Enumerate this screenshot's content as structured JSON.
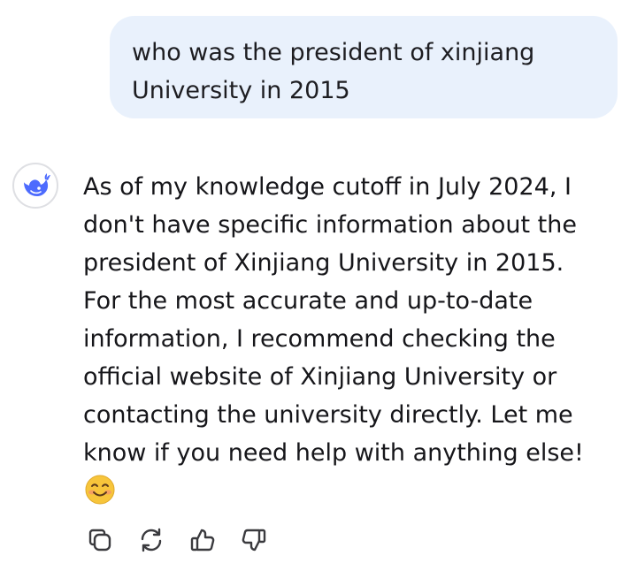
{
  "conversation": {
    "user_message": "who was the president of xinjiang University in 2015",
    "assistant_message": "As of my knowledge cutoff in July 2024, I\ndon't have specific information about the\npresident of Xinjiang University in 2015.\nFor the most accurate and up-to-date\ninformation, I recommend checking the\nofficial website of Xinjiang University or\ncontacting the university directly. Let me\nknow if you need help with anything else!",
    "emoji_icon": "smiling-face-emoji",
    "avatar_icon": "deepseek-whale-logo"
  },
  "actions": [
    {
      "icon": "copy-icon"
    },
    {
      "icon": "regenerate-icon"
    },
    {
      "icon": "thumbs-up-icon"
    },
    {
      "icon": "thumbs-down-icon"
    }
  ],
  "colors": {
    "user_bubble_bg": "#e9f1fc",
    "logo_blue": "#4d6bfe",
    "icon_gray": "#3a3a3e",
    "emoji_yellow": "#f7c53b"
  }
}
